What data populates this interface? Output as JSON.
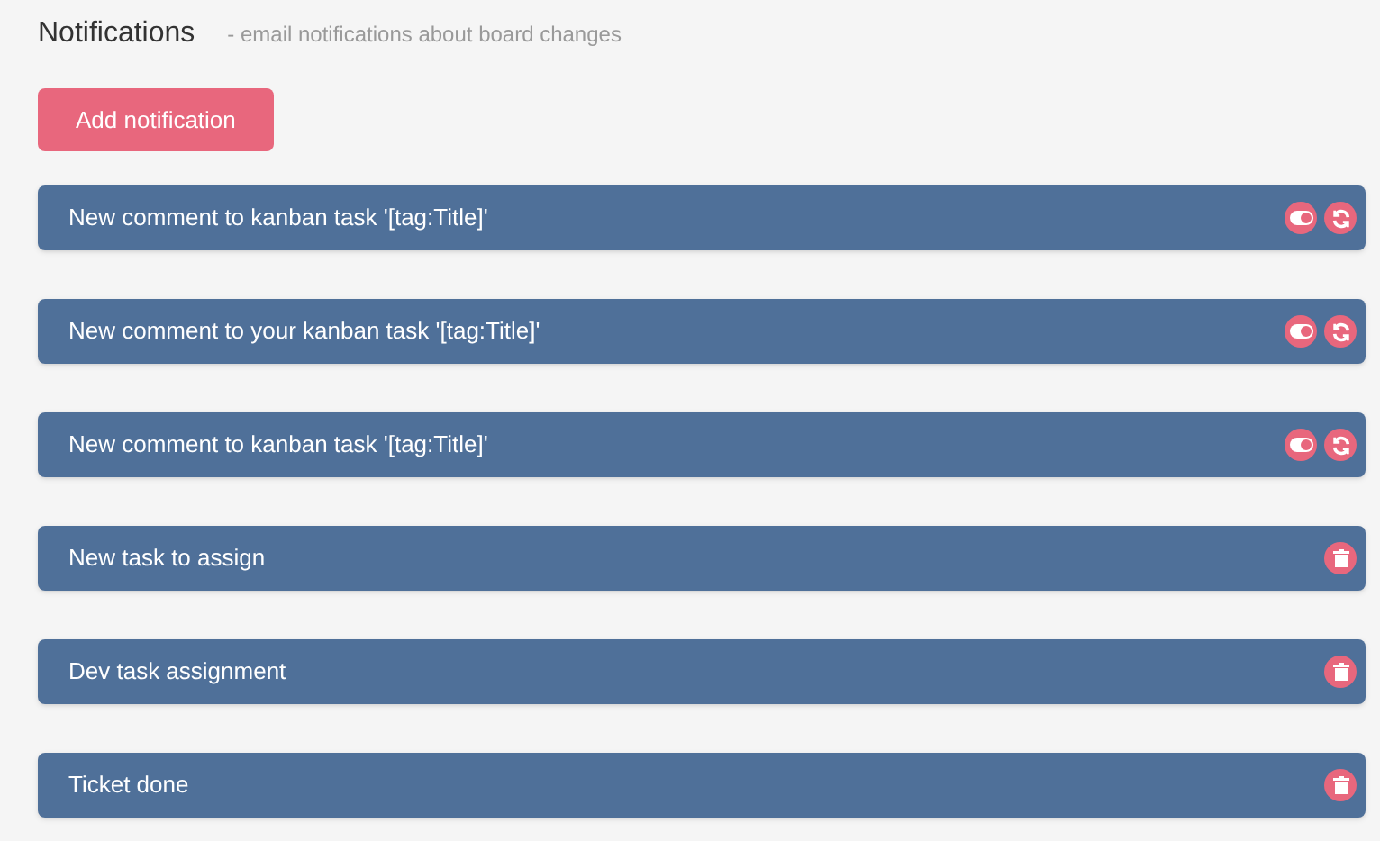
{
  "header": {
    "title": "Notifications",
    "subtitle": "- email notifications about board changes"
  },
  "add_button": "Add notification",
  "notifications": [
    {
      "label": "New comment to kanban task '[tag:Title]'",
      "kind": "system",
      "on": true
    },
    {
      "label": "New comment to your kanban task '[tag:Title]'",
      "kind": "system",
      "on": true
    },
    {
      "label": "New comment to kanban task '[tag:Title]'",
      "kind": "system",
      "on": true
    },
    {
      "label": "New task to assign",
      "kind": "custom"
    },
    {
      "label": "Dev task assignment",
      "kind": "custom"
    },
    {
      "label": "Ticket done",
      "kind": "custom"
    }
  ]
}
